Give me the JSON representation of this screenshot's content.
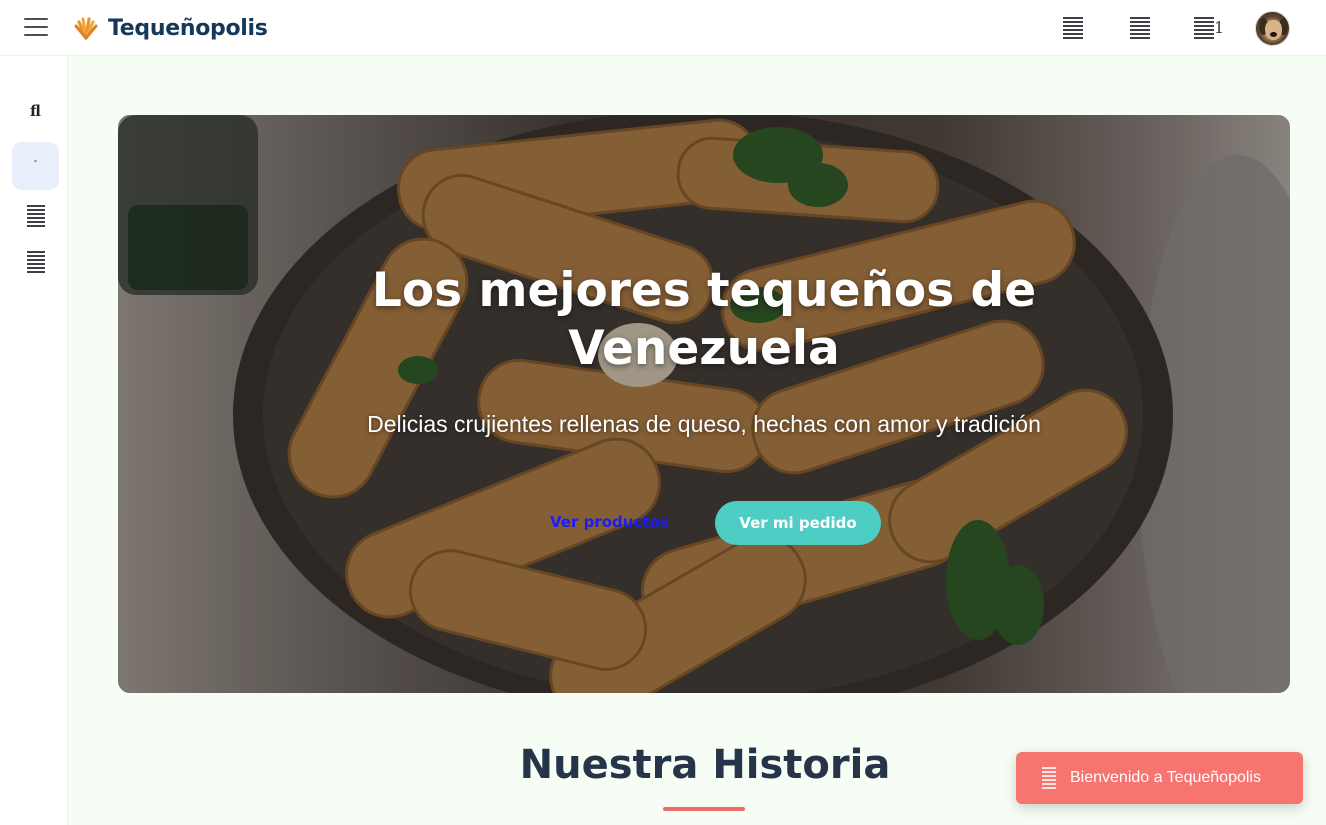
{
  "header": {
    "brand_name": "Tequeñopolis",
    "cart_count": "1",
    "icons": [
      "menu-icon",
      "brand-logo-icon",
      "nav-icon",
      "nav-icon",
      "cart-icon",
      "user-avatar"
    ]
  },
  "sidebar": {
    "items": [
      {
        "glyph": "fl",
        "icon": "home-icon"
      },
      {
        "glyph": "-",
        "icon": "products-icon",
        "active": true
      },
      {
        "glyph": "",
        "icon": "orders-icon"
      },
      {
        "glyph": "",
        "icon": "list-icon"
      }
    ]
  },
  "hero": {
    "title": "Los mejores tequeños de Venezuela",
    "subtitle": "Delicias crujientes rellenas de queso, hechas con amor y tradición",
    "link_label": "Ver productos",
    "button_label": "Ver mi pedido"
  },
  "history": {
    "title": "Nuestra Historia"
  },
  "toast": {
    "message": "Bienvenido a Tequeñopolis"
  },
  "colors": {
    "brand": "#14385a",
    "accent_teal": "#4ecdc4",
    "accent_coral": "#f77470",
    "link_blue": "#1a1aff",
    "page_bg": "#f5fdf4"
  }
}
